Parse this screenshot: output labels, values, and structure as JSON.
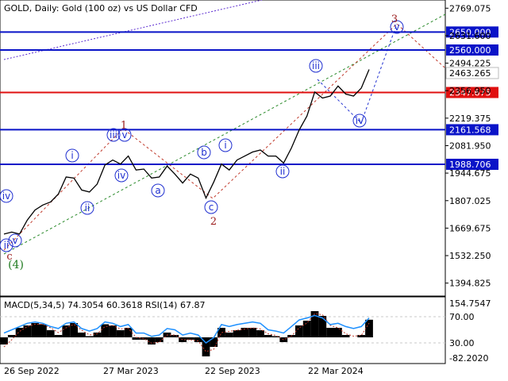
{
  "header": {
    "symbol_text": "GOLD, Daily:  Gold (100 oz) vs US Dollar CFD",
    "indicator_text": "MACD(5,34,5) 74.3054 60.3618 RSI(14) 67.87"
  },
  "colors": {
    "price_line": "#000000",
    "level_blue": "#0a14c8",
    "level_red": "#e01010",
    "current_price_bg": "#ffffff",
    "wave_blue": "#1f2fd0",
    "wave_red": "#9b1b1b",
    "wave_green": "#1f7a1f",
    "trend_green": "#2a8a2a",
    "trend_purple": "#5a2ad0",
    "grid": "#c8c8c8"
  },
  "chart_data": [
    {
      "type": "line",
      "title": "GOLD, Daily:  Gold (100 oz) vs US Dollar CFD",
      "x": [
        "2022-09-26",
        "2022-10-10",
        "2022-10-24",
        "2022-11-07",
        "2022-11-21",
        "2022-12-05",
        "2022-12-19",
        "2023-01-02",
        "2023-01-16",
        "2023-01-30",
        "2023-02-13",
        "2023-02-27",
        "2023-03-13",
        "2023-03-27",
        "2023-04-10",
        "2023-04-24",
        "2023-05-08",
        "2023-05-22",
        "2023-06-05",
        "2023-06-19",
        "2023-07-03",
        "2023-07-17",
        "2023-07-31",
        "2023-08-14",
        "2023-08-28",
        "2023-09-11",
        "2023-09-25",
        "2023-10-09",
        "2023-10-23",
        "2023-11-06",
        "2023-11-20",
        "2023-12-04",
        "2023-12-18",
        "2024-01-01",
        "2024-01-15",
        "2024-01-29",
        "2024-02-12",
        "2024-02-26",
        "2024-03-11",
        "2024-03-25",
        "2024-04-08",
        "2024-04-22",
        "2024-05-06",
        "2024-05-20",
        "2024-06-03",
        "2024-06-17",
        "2024-07-01",
        "2024-07-15"
      ],
      "series": [
        {
          "values": [
            1640,
            1650,
            1640,
            1710,
            1760,
            1785,
            1800,
            1840,
            1925,
            1920,
            1860,
            1850,
            1890,
            1985,
            2010,
            1990,
            2030,
            1960,
            1965,
            1920,
            1925,
            1980,
            1940,
            1895,
            1940,
            1920,
            1820,
            1900,
            1990,
            1960,
            2010,
            2030,
            2050,
            2060,
            2030,
            2030,
            1995,
            2070,
            2160,
            2230,
            2350,
            2320,
            2330,
            2380,
            2340,
            2330,
            2370,
            2463
          ]
        }
      ],
      "yaxis_ticks": [
        "2769.075",
        "2631.600",
        "2494.225",
        "2356.950",
        "2219.375",
        "2081.950",
        "1944.675",
        "1807.025",
        "1669.675",
        "1532.250",
        "1394.825"
      ],
      "xaxis_ticks": [
        "26 Sep 2022",
        "27 Mar 2023",
        "22 Sep 2023",
        "22 Mar 2024"
      ],
      "ylim": [
        1330,
        2810
      ],
      "levels": [
        {
          "label": "2650.000",
          "value": 2650.0,
          "color": "blue"
        },
        {
          "label": "2560.000",
          "value": 2560.0,
          "color": "blue"
        },
        {
          "label": "2347.675",
          "value": 2347.675,
          "color": "red"
        },
        {
          "label": "2161.568",
          "value": 2161.568,
          "color": "blue"
        },
        {
          "label": "1988.706",
          "value": 1988.706,
          "color": "blue"
        }
      ],
      "current_price": "2463.265",
      "wave_labels": [
        {
          "text": "iv",
          "color": "blue"
        },
        {
          "text": "ii",
          "color": "blue"
        },
        {
          "text": "v",
          "color": "blue"
        },
        {
          "text": "c",
          "color": "red"
        },
        {
          "text": "(4)",
          "color": "green"
        },
        {
          "text": "i",
          "color": "blue"
        },
        {
          "text": "ii",
          "color": "blue"
        },
        {
          "text": "iii",
          "color": "blue"
        },
        {
          "text": "v",
          "color": "blue"
        },
        {
          "text": "1",
          "color": "red"
        },
        {
          "text": "iv",
          "color": "blue"
        },
        {
          "text": "a",
          "color": "blue"
        },
        {
          "text": "b",
          "color": "blue"
        },
        {
          "text": "c",
          "color": "blue"
        },
        {
          "text": "2",
          "color": "red"
        },
        {
          "text": "i",
          "color": "blue"
        },
        {
          "text": "ii",
          "color": "blue"
        },
        {
          "text": "iii",
          "color": "blue"
        },
        {
          "text": "iv",
          "color": "blue"
        },
        {
          "text": "v",
          "color": "blue"
        },
        {
          "text": "3",
          "color": "red"
        }
      ]
    },
    {
      "type": "bar",
      "title": "MACD(5,34,5) 74.3054 60.3618 RSI(14) 67.87",
      "series": [
        {
          "values": [
            -30,
            10,
            40,
            50,
            60,
            55,
            30,
            10,
            50,
            60,
            20,
            5,
            20,
            55,
            50,
            30,
            40,
            -10,
            -10,
            -30,
            -20,
            20,
            10,
            -20,
            -10,
            -20,
            -80,
            -40,
            40,
            20,
            30,
            40,
            40,
            30,
            10,
            5,
            -20,
            10,
            50,
            70,
            110,
            90,
            40,
            40,
            10,
            0,
            10,
            74
          ]
        },
        {
          "values": [
            -40,
            -10,
            25,
            45,
            55,
            55,
            40,
            20,
            40,
            55,
            30,
            10,
            15,
            45,
            50,
            35,
            38,
            0,
            -5,
            -25,
            -20,
            10,
            10,
            -10,
            -10,
            -15,
            -60,
            -50,
            20,
            25,
            30,
            35,
            40,
            35,
            15,
            8,
            -10,
            5,
            40,
            60,
            100,
            95,
            50,
            40,
            15,
            5,
            8,
            60
          ]
        },
        {
          "values": [
            45,
            50,
            55,
            60,
            62,
            60,
            55,
            52,
            60,
            62,
            52,
            48,
            52,
            62,
            60,
            55,
            58,
            45,
            45,
            40,
            42,
            52,
            50,
            42,
            45,
            42,
            30,
            38,
            58,
            55,
            58,
            60,
            62,
            60,
            50,
            48,
            45,
            55,
            65,
            68,
            72,
            68,
            58,
            60,
            55,
            52,
            55,
            68
          ]
        }
      ],
      "yaxis_ticks": [
        "154.7547",
        "70.00",
        "30.00",
        "-82.2020"
      ],
      "ylim": [
        -100,
        165
      ]
    }
  ]
}
